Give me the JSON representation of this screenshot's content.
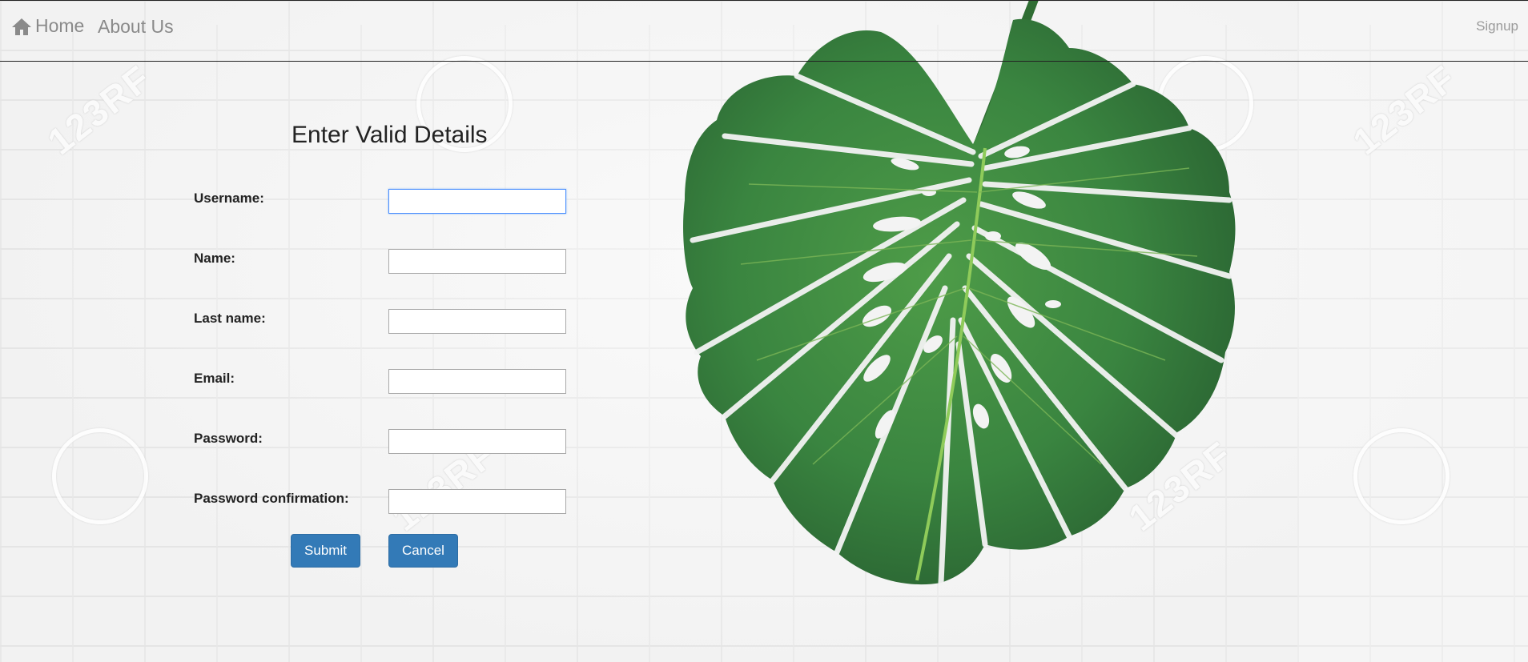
{
  "nav": {
    "home_label": "Home",
    "about_label": "About Us",
    "signup_label": "Signup"
  },
  "form": {
    "title": "Enter Valid Details",
    "fields": [
      {
        "label": "Username:",
        "value": ""
      },
      {
        "label": "Name:",
        "value": ""
      },
      {
        "label": "Last name:",
        "value": ""
      },
      {
        "label": "Email:",
        "value": ""
      },
      {
        "label": "Password:",
        "value": ""
      },
      {
        "label": "Password confirmation:",
        "value": ""
      }
    ],
    "submit_label": "Submit",
    "cancel_label": "Cancel"
  },
  "watermark": {
    "text": "123RF"
  },
  "colors": {
    "button_bg": "#337ab7",
    "nav_text": "#8a8a8a",
    "leaf_dark": "#2d6b35",
    "leaf_light": "#4f9a4a",
    "vein": "#8fcb5a"
  },
  "icons": {
    "home": "home-icon",
    "leaf": "monstera-leaf-image"
  }
}
